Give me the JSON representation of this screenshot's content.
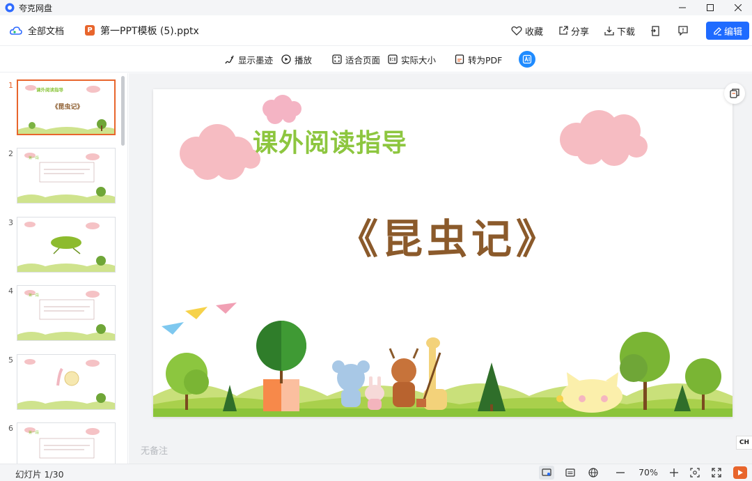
{
  "app": {
    "name": "夸克网盘"
  },
  "header": {
    "all_docs": "全部文档",
    "file_badge": "P",
    "file_name": "第一PPT模板 (5).pptx",
    "favorite": "收藏",
    "share": "分享",
    "download": "下载",
    "edit": "编辑"
  },
  "viewbar": {
    "show_ink": "显示墨迹",
    "play": "播放",
    "fit_page": "适合页面",
    "actual_size": "实际大小",
    "to_pdf": "转为PDF"
  },
  "sidebar": {
    "thumbnails": [
      {
        "num": "1",
        "title": "课外阅读指导",
        "text": "《昆虫记》"
      },
      {
        "num": "2",
        "title": "第一段",
        "text": ""
      },
      {
        "num": "3",
        "title": "",
        "text": ""
      },
      {
        "num": "4",
        "title": "第一段",
        "text": ""
      },
      {
        "num": "5",
        "title": "",
        "text": ""
      },
      {
        "num": "6",
        "title": "第一段",
        "text": ""
      }
    ]
  },
  "slide": {
    "title": "课外阅读指导",
    "subtitle": "《昆虫记》"
  },
  "notes": {
    "placeholder": "无备注"
  },
  "ime": {
    "label": "CH"
  },
  "status": {
    "slide_count": "幻灯片 1/30",
    "zoom": "70%"
  },
  "colors": {
    "accent": "#1f6bff",
    "ppt_orange": "#e8652c",
    "title_green": "#8dc63f",
    "subtitle_brown": "#8b5a2b"
  }
}
